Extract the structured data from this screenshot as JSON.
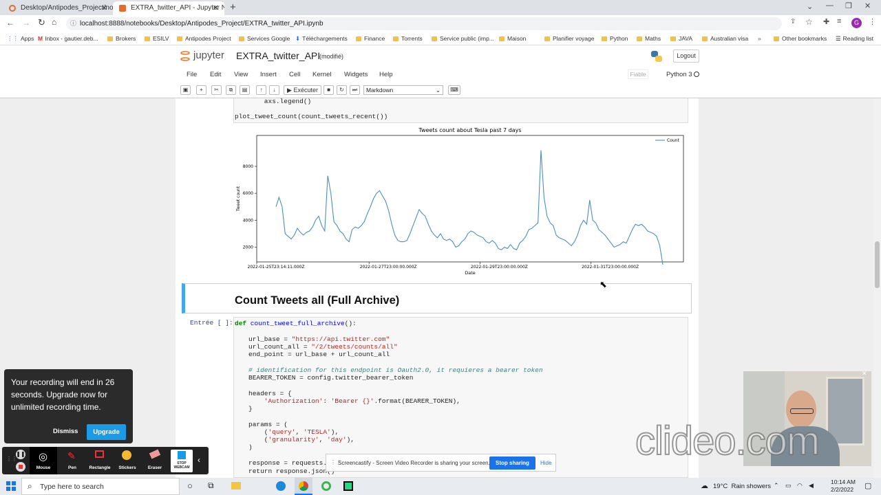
{
  "browser": {
    "tabs": [
      {
        "label": "Desktop/Antipodes_Project/note",
        "active": false
      },
      {
        "label": "EXTRA_twitter_API - Jupyter Note",
        "active": true
      }
    ],
    "url": "localhost:8888/notebooks/Desktop/Antipodes_Project/EXTRA_twitter_API.ipynb",
    "bookmarks": [
      "Apps",
      "Inbox - gautier.deb...",
      "Brokers",
      "ESILV",
      "Antipodes Project",
      "Services Google",
      "Téléchargements",
      "Finance",
      "Torrents",
      "Service public (imp...",
      "Maison",
      "Planifier voyage",
      "Python",
      "Maths",
      "JAVA",
      "Australian visa",
      "Other bookmarks",
      "Reading list"
    ],
    "profile_initial": "G"
  },
  "jupyter": {
    "logo_text": "jupyter",
    "notebook_name": "EXTRA_twitter_API",
    "status": "(modifié)",
    "logout": "Logout",
    "menu": [
      "File",
      "Edit",
      "View",
      "Insert",
      "Cell",
      "Kernel",
      "Widgets",
      "Help"
    ],
    "trusted": "Fiable",
    "kernel": "Python 3",
    "run_label": "Exécuter",
    "cell_type": "Markdown"
  },
  "cells": {
    "prev_code_line1": "    axs.legend()",
    "prev_code_line2": "plot_tweet_count(count_tweets_recent())",
    "heading": "Count Tweets all (Full Archive)",
    "prompt": "Entrée [ ]:",
    "code": {
      "l1a": "def",
      "l1b": " count_tweet_full_archive",
      "l1c": "():",
      "l2a": "url_base = ",
      "l2b": "\"https://api.twitter.com\"",
      "l3a": "url_count_all = ",
      "l3b": "\"/2/tweets/counts/all\"",
      "l4": "end_point = url_base + url_count_all",
      "l5": "# identification for this endpoint is Oauth2.0, it requieres a bearer token",
      "l6": "BEARER_TOKEN = config.twitter_bearer_token",
      "l7": "headers = {",
      "l8a": "    'Authorization'",
      "l8b": ": ",
      "l8c": "'Bearer {}'",
      "l8d": ".format(BEARER_TOKEN),",
      "l9": "}",
      "l10": "params = (",
      "l11a": "    (",
      "l11b": "'query'",
      "l11c": ", ",
      "l11d": "'TESLA'",
      "l11e": "),",
      "l12a": "    (",
      "l12b": "'granularity'",
      "l12c": ", ",
      "l12d": "'day'",
      "l12e": "),",
      "l13": ")",
      "l14": "response = requests.ge",
      "l15": "return response.json()"
    }
  },
  "chart_data": {
    "type": "line",
    "title": "Tweets count about Tesla past 7 days",
    "xlabel": "Date",
    "ylabel": "Tweet count",
    "x_ticks": [
      "2022-01-25T23:14:11.000Z",
      "2022-01-27T23:00:00.000Z",
      "2022-01-29T23:00:00.000Z",
      "2022-01-31T23:00:00.000Z"
    ],
    "y_ticks": [
      2000,
      4000,
      6000,
      8000
    ],
    "ylim": [
      900,
      10300
    ],
    "legend": "Count",
    "legend_position": "upper-right",
    "series": [
      {
        "name": "Count",
        "values": [
          5000,
          5700,
          5000,
          3000,
          2800,
          2600,
          2900,
          3400,
          3100,
          2900,
          3100,
          3200,
          3500,
          4000,
          4300,
          3600,
          3200,
          7300,
          6000,
          3900,
          3600,
          3200,
          3000,
          2600,
          2400,
          3300,
          3500,
          3400,
          3600,
          3900,
          4500,
          5000,
          5600,
          6000,
          6200,
          5800,
          5400,
          4700,
          3700,
          2900,
          2500,
          2400,
          2400,
          2500,
          3000,
          3600,
          4200,
          4800,
          4500,
          4300,
          3700,
          3200,
          2900,
          2700,
          3000,
          2600,
          2500,
          2600,
          2400,
          2000,
          2100,
          2400,
          2600,
          3000,
          3200,
          3100,
          2900,
          2800,
          2700,
          2400,
          2300,
          2500,
          2300,
          1900,
          1800,
          2000,
          1900,
          2200,
          1900,
          1800,
          2300,
          2500,
          2800,
          3300,
          3400,
          3600,
          3800,
          9200,
          5700,
          4300,
          3800,
          3600,
          2900,
          2700,
          2600,
          2500,
          2300,
          2100,
          2400,
          2900,
          3600,
          4000,
          3700,
          5500,
          4000,
          3800,
          3300,
          3100,
          2900,
          2600,
          2300,
          2000,
          2100,
          2200,
          2400,
          2300,
          2800,
          3300,
          3700,
          3600,
          3700,
          3500,
          3200,
          3100,
          3000,
          2800,
          2100,
          700
        ]
      }
    ]
  },
  "recording": {
    "message": "Your recording will end in 26 seconds. Upgrade now for unlimited recording time.",
    "dismiss": "Dismiss",
    "upgrade": "Upgrade",
    "tools": [
      "Mouse",
      "Pen",
      "Rectangle",
      "Stickers",
      "Eraser",
      "STOP WEBCAM"
    ]
  },
  "share_bar": {
    "message": "Screencastify - Screen Video Recorder is sharing your screen.",
    "stop": "Stop sharing",
    "hide": "Hide"
  },
  "watermark": "clideo.com",
  "taskbar": {
    "search_placeholder": "Type here to search",
    "weather": "19°C  Rain showers",
    "time": "10:14 AM",
    "date": "2/2/2022"
  }
}
